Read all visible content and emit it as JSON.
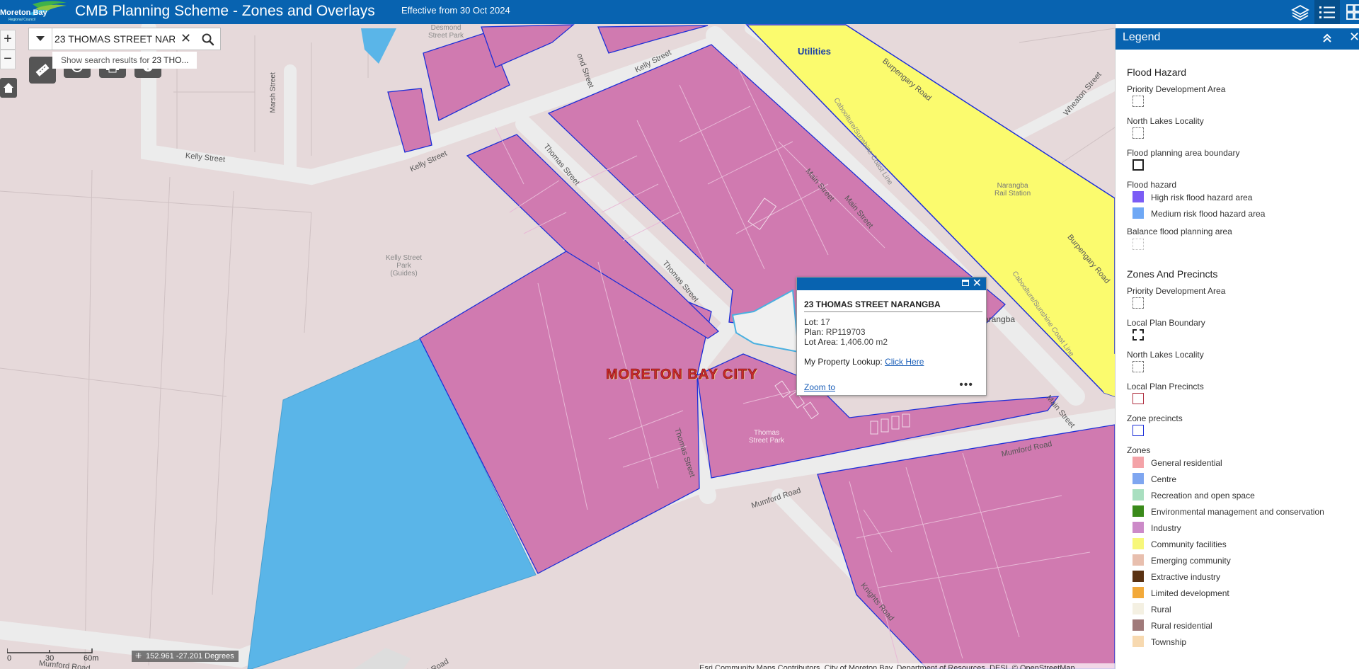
{
  "header": {
    "logo_text": "Moreton Bay",
    "logo_subtext": "Regional Council",
    "title": "CMB Planning Scheme - Zones and Overlays",
    "effective": "Effective from 30 Oct 2024",
    "icons": [
      "layers-icon",
      "legend-list-icon",
      "basemap-icon"
    ]
  },
  "search": {
    "value": "23 THOMAS STREET NAR",
    "suggest_prefix": "Show search results for ",
    "suggest_term": "23 THO..."
  },
  "tools": {
    "zoom_in": "+",
    "zoom_out": "−",
    "icons": [
      "measure-icon",
      "bookmark-icon",
      "print-icon",
      "info-icon",
      "home-icon"
    ]
  },
  "map": {
    "labels": {
      "utilities": "Utilities",
      "mbc": "MORETON BAY CITY",
      "narangba_partial": "arangba",
      "narangba_rail": "Narangba\nRail Station",
      "kelly_park": "Kelly Street\nPark\n(Guides)",
      "thomas_park": "Thomas\nStreet Park",
      "desmond_park": "Desmond\nStreet Park"
    },
    "streets": {
      "kelly_1": "Kelly Street",
      "kelly_2": "Kelly Street",
      "kelly_3": "Kelly Street",
      "marsh": "Marsh Street",
      "thomas_1": "Thomas Street",
      "thomas_2": "Thomas Street",
      "thomas_3": "Thomas Street",
      "main_1": "Main Street",
      "main_2": "Main Street",
      "main_3": "Main Street",
      "burpengary_1": "Burpengary Road",
      "burpengary_2": "Burpengary Road",
      "wheaton": "Wheaton Street",
      "mumford_1": "Mumford Road",
      "mumford_2": "Mumford Road",
      "mumford_3": "Mumford Road",
      "mumford_4": "Mumford Road",
      "knights": "Knights Road",
      "rail_1": "Caboolture/Sunshine Coast Line",
      "rail_2": "Caboolture/Sunshine Coast Line",
      "desmond": "ond Street"
    }
  },
  "popup": {
    "title": "23 THOMAS STREET NARANGBA",
    "lot_label": "Lot:",
    "lot_value": "17",
    "plan_label": "Plan:",
    "plan_value": "RP119703",
    "area_label": "Lot Area:",
    "area_value": "1,406.00 m2",
    "lookup_label": "My Property Lookup:",
    "lookup_link": "Click Here",
    "zoom_to": "Zoom to",
    "more": "•••"
  },
  "legend": {
    "title": "Legend",
    "flood": {
      "section": "Flood Hazard",
      "pda": "Priority Development Area",
      "nll": "North Lakes Locality",
      "fpab": "Flood planning area boundary",
      "fh": "Flood hazard",
      "high": "High risk flood hazard area",
      "medium": "Medium risk flood hazard area",
      "balance": "Balance flood planning area",
      "high_color": "#7b5cf5",
      "medium_color": "#6fa8f5"
    },
    "zones_section": "Zones And Precincts",
    "zp": {
      "pda": "Priority Development Area",
      "lpb": "Local Plan Boundary",
      "nll": "North Lakes Locality",
      "lpp": "Local Plan Precincts",
      "zprec": "Zone precincts",
      "zones": "Zones"
    },
    "zones": [
      {
        "label": "General residential",
        "color": "#f4a3a8"
      },
      {
        "label": "Centre",
        "color": "#7fa6f0"
      },
      {
        "label": "Recreation and open space",
        "color": "#a9dfc0"
      },
      {
        "label": "Environmental management and conservation",
        "color": "#3a8a1a"
      },
      {
        "label": "Industry",
        "color": "#cc8ac8"
      },
      {
        "label": "Community facilities",
        "color": "#f7f77a"
      },
      {
        "label": "Emerging community",
        "color": "#e8bfae"
      },
      {
        "label": "Extractive industry",
        "color": "#5a3212"
      },
      {
        "label": "Limited development",
        "color": "#f2a93a"
      },
      {
        "label": "Rural",
        "color": "#f4f0e2"
      },
      {
        "label": "Rural residential",
        "color": "#a07a7a"
      },
      {
        "label": "Township",
        "color": "#f7d9b0"
      }
    ]
  },
  "footer": {
    "scale": [
      "0",
      "30",
      "60m"
    ],
    "coords": "152.961 -27.201 Degrees",
    "attribution": "Esri Community Maps Contributors, City of Moreton Bay, Department of Resources, DESI, © OpenStreetMap"
  }
}
